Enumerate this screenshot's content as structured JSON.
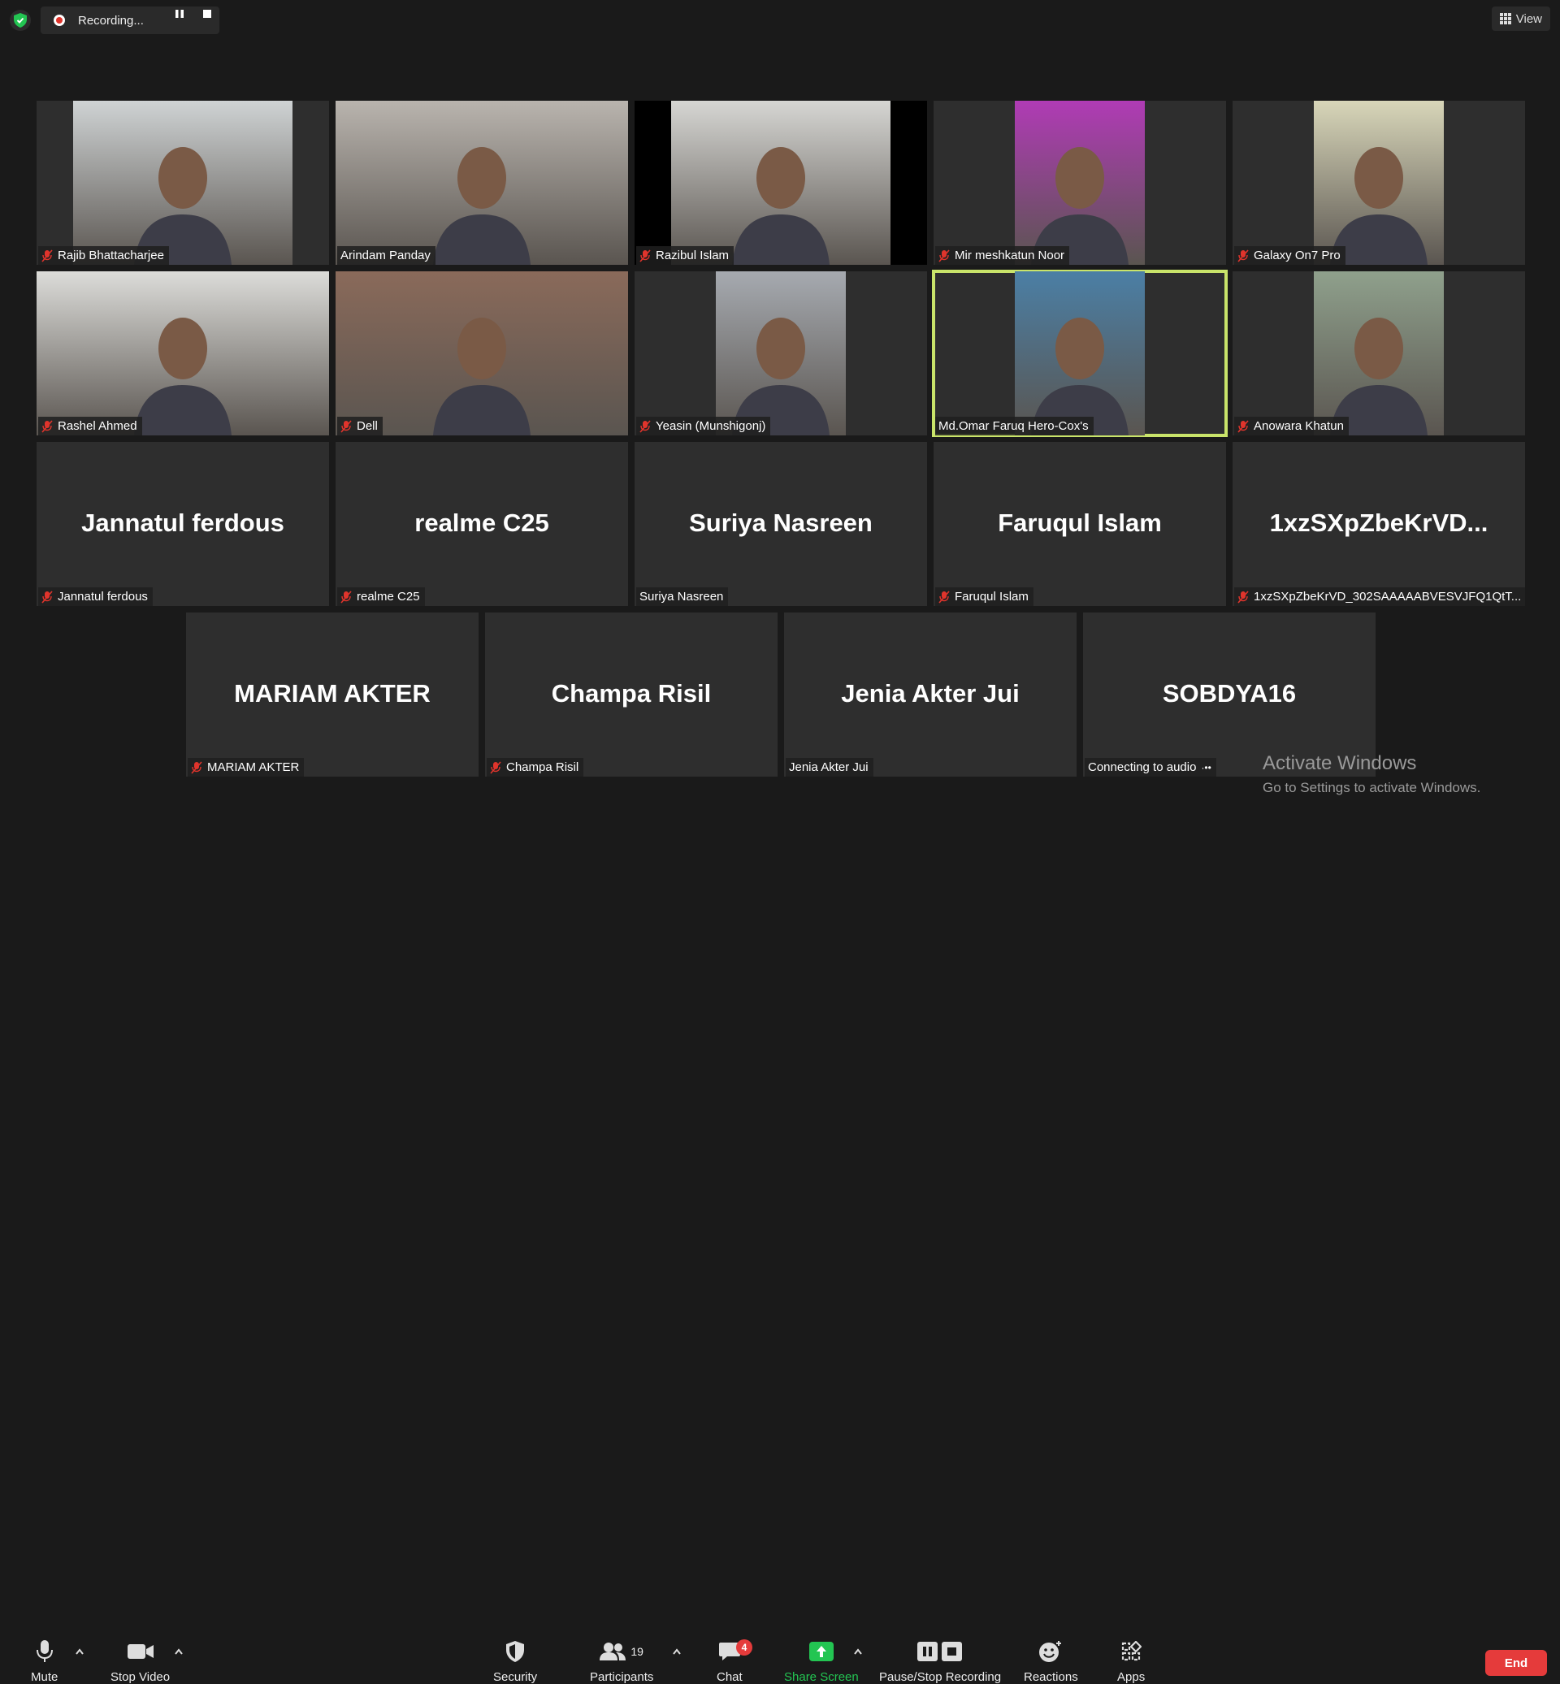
{
  "recording": {
    "status_label": "Recording..."
  },
  "view_button": {
    "label": "View"
  },
  "participants": [
    {
      "name": "Rajib Bhattacharjee",
      "muted": true,
      "video": true,
      "bg": "#cfd3d4"
    },
    {
      "name": "Arindam Panday",
      "muted": false,
      "video": true,
      "bg": "#b9b4ae"
    },
    {
      "name": "Razibul Islam",
      "muted": true,
      "video": true,
      "bg": "#d6d6d3"
    },
    {
      "name": "Mir meshkatun Noor",
      "muted": true,
      "video": true,
      "bg": "#b03bb5"
    },
    {
      "name": "Galaxy On7 Pro",
      "muted": true,
      "video": true,
      "bg": "#d8d6b9"
    },
    {
      "name": "Rashel Ahmed",
      "muted": true,
      "video": true,
      "bg": "#dcdcd9"
    },
    {
      "name": "Dell",
      "muted": true,
      "video": true,
      "bg": "#8a6a5a"
    },
    {
      "name": "Yeasin (Munshigonj)",
      "muted": true,
      "video": true,
      "bg": "#a6aab0"
    },
    {
      "name": "Md.Omar Faruq Hero-Cox's",
      "muted": false,
      "video": true,
      "bg": "#4b7fa5"
    },
    {
      "name": "Anowara Khatun",
      "muted": true,
      "video": true,
      "bg": "#8fa08c"
    },
    {
      "name": "Jannatul ferdous",
      "big": "Jannatul ferdous",
      "muted": true
    },
    {
      "name": "realme C25",
      "big": "realme C25",
      "muted": true
    },
    {
      "name": "Suriya Nasreen",
      "big": "Suriya Nasreen",
      "muted": false
    },
    {
      "name": "Faruqul Islam",
      "big": "Faruqul Islam",
      "muted": true
    },
    {
      "name": "1xzSXpZbeKrVD_302SAAAAABVESVJFQ1QtT...",
      "big": "1xzSXpZbeKrVD...",
      "muted": true
    },
    {
      "name": "MARIAM AKTER",
      "big": "MARIAM AKTER",
      "muted": true
    },
    {
      "name": "Champa Risil",
      "big": "Champa Risil",
      "muted": true
    },
    {
      "name": "Jenia Akter Jui",
      "big": "Jenia Akter Jui",
      "muted": false
    },
    {
      "name": "Connecting to audio",
      "big": "SOBDYA16",
      "muted": false,
      "connecting": true
    }
  ],
  "watermark": {
    "title": "Activate Windows",
    "subtitle": "Go to Settings to activate Windows."
  },
  "toolbar": {
    "mute": "Mute",
    "stop_video": "Stop Video",
    "security": "Security",
    "participants": "Participants",
    "participants_count": "19",
    "chat": "Chat",
    "chat_badge": "4",
    "share_screen": "Share Screen",
    "pause_stop_recording": "Pause/Stop Recording",
    "reactions": "Reactions",
    "apps": "Apps",
    "end": "End"
  },
  "colors": {
    "active_speaker": "#c9e46a",
    "end_button": "#e53b3b",
    "share_green": "#23c552",
    "mute_red": "#e0342c"
  },
  "icons": [
    "shield-icon",
    "record-icon",
    "pause-icon",
    "stop-icon",
    "grid-icon",
    "mic-icon",
    "video-icon",
    "security-shield-icon",
    "participants-icon",
    "chat-icon",
    "share-arrow-icon",
    "recording-controls-icon",
    "reactions-icon",
    "apps-icon",
    "muted-mic-icon"
  ]
}
